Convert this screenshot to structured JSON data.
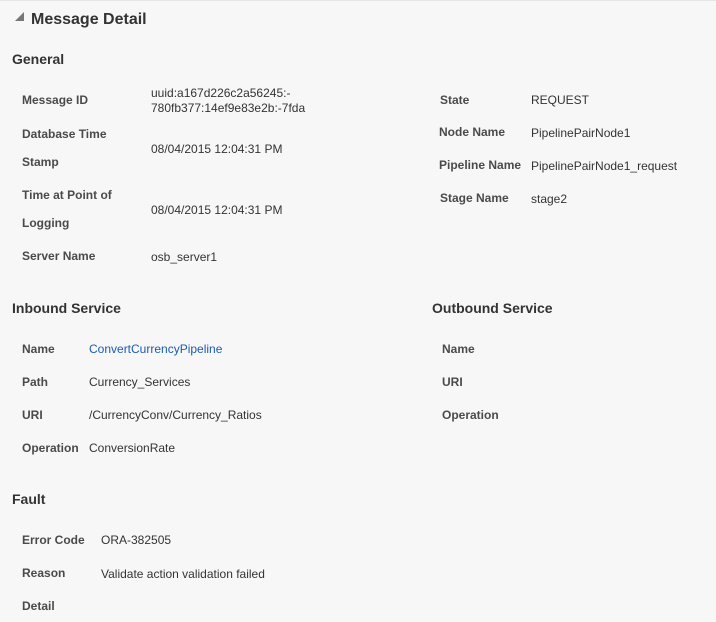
{
  "page": {
    "title": "Message Detail"
  },
  "general": {
    "heading": "General",
    "message_id": {
      "label": "Message ID",
      "value_line1": "uuid:a167d226c2a56245:-",
      "value_line2": "780fb377:14ef9e83e2b:-7fda"
    },
    "database_time_stamp": {
      "label_line1": "Database Time",
      "label_line2": "Stamp",
      "value": "08/04/2015 12:04:31 PM"
    },
    "time_at_point_of_logging": {
      "label_line1": "Time at Point of",
      "label_line2": "Logging",
      "value": "08/04/2015 12:04:31 PM"
    },
    "server_name": {
      "label": "Server Name",
      "value": "osb_server1"
    },
    "state": {
      "label": "State",
      "value": "REQUEST"
    },
    "node_name": {
      "label": "Node Name",
      "value": "PipelinePairNode1"
    },
    "pipeline_name": {
      "label": "Pipeline Name",
      "value": "PipelinePairNode1_request"
    },
    "stage_name": {
      "label": "Stage Name",
      "value": "stage2"
    }
  },
  "inbound": {
    "heading": "Inbound Service",
    "name": {
      "label": "Name",
      "value": "ConvertCurrencyPipeline"
    },
    "path": {
      "label": "Path",
      "value": "Currency_Services"
    },
    "uri": {
      "label": "URI",
      "value": "/CurrencyConv/Currency_Ratios"
    },
    "operation": {
      "label": "Operation",
      "value": "ConversionRate"
    }
  },
  "outbound": {
    "heading": "Outbound Service",
    "name": {
      "label": "Name",
      "value": ""
    },
    "uri": {
      "label": "URI",
      "value": ""
    },
    "operation": {
      "label": "Operation",
      "value": ""
    }
  },
  "fault": {
    "heading": "Fault",
    "error_code": {
      "label": "Error Code",
      "value": "ORA-382505"
    },
    "reason": {
      "label": "Reason",
      "value": "Validate action validation failed"
    },
    "detail": {
      "label": "Detail",
      "value": ""
    }
  }
}
